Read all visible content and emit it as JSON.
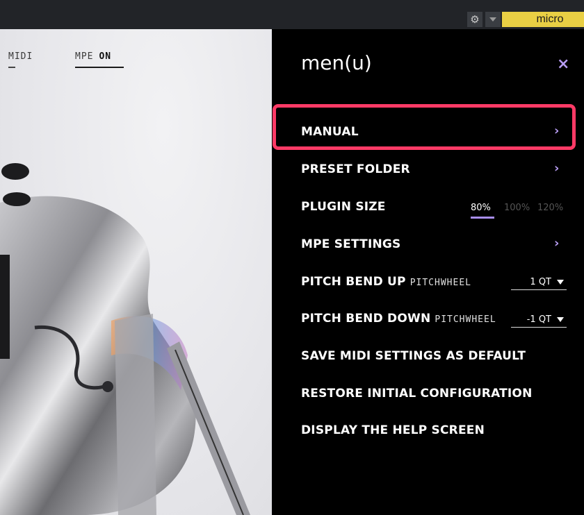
{
  "host": {
    "gear_icon": "gear-icon",
    "preset_name": "micro",
    "preset_color": "#e9cf44"
  },
  "modes": {
    "midi_label": "MIDI",
    "mpe_label": "MPE",
    "mpe_state": "ON"
  },
  "menu": {
    "title": "men(u)",
    "close_glyph": "×",
    "accent": "#b79cf2",
    "highlight_color": "#ff3a66",
    "items": {
      "manual": "MANUAL",
      "preset_folder": "PRESET FOLDER",
      "plugin_size": "PLUGIN SIZE",
      "mpe_settings": "MPE SETTINGS",
      "pitch_bend_up": "PITCH BEND UP",
      "pitch_bend_up_sub": "PITCHWHEEL",
      "pitch_bend_down": "PITCH BEND DOWN",
      "pitch_bend_down_sub": "PITCHWHEEL",
      "save_midi": "SAVE MIDI SETTINGS AS DEFAULT",
      "restore": "RESTORE INITIAL CONFIGURATION",
      "help": "DISPLAY THE HELP SCREEN"
    },
    "chevron": "›",
    "sizes": [
      "80%",
      "100%",
      "120%"
    ],
    "size_selected": "80%",
    "pitch_bend_up_value": "1 QT",
    "pitch_bend_down_value": "-1 QT"
  }
}
